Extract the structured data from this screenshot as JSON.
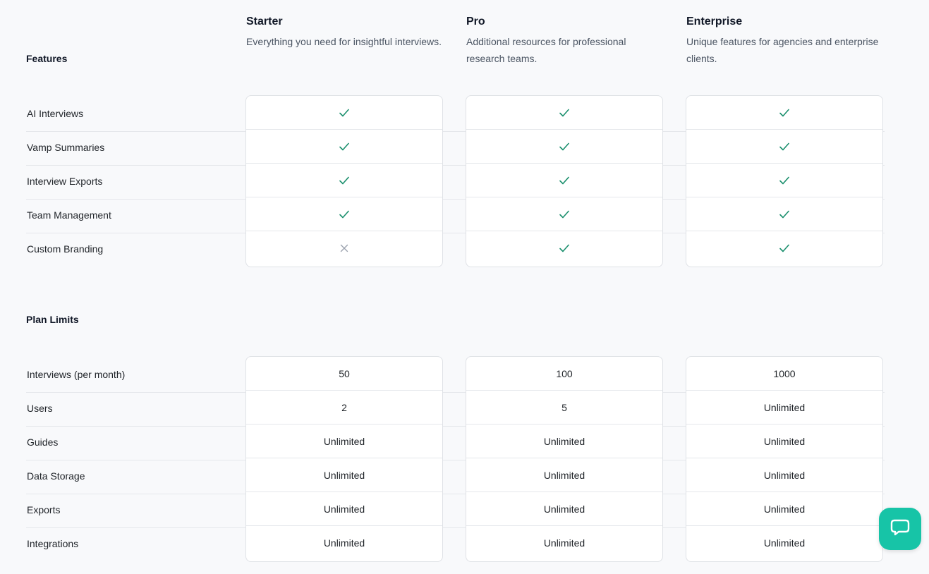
{
  "plans": [
    {
      "name": "Starter",
      "description": "Everything you need for insightful interviews."
    },
    {
      "name": "Pro",
      "description": "Additional resources for professional research teams."
    },
    {
      "name": "Enterprise",
      "description": "Unique features for agencies and enterprise clients."
    }
  ],
  "features": {
    "title": "Features",
    "rows": [
      {
        "label": "AI Interviews",
        "values": [
          "check",
          "check",
          "check"
        ]
      },
      {
        "label": "Vamp Summaries",
        "values": [
          "check",
          "check",
          "check"
        ]
      },
      {
        "label": "Interview Exports",
        "values": [
          "check",
          "check",
          "check"
        ]
      },
      {
        "label": "Team Management",
        "values": [
          "check",
          "check",
          "check"
        ]
      },
      {
        "label": "Custom Branding",
        "values": [
          "cross",
          "check",
          "check"
        ]
      }
    ]
  },
  "limits": {
    "title": "Plan Limits",
    "rows": [
      {
        "label": "Interviews (per month)",
        "values": [
          "50",
          "100",
          "1000"
        ]
      },
      {
        "label": "Users",
        "values": [
          "2",
          "5",
          "Unlimited"
        ]
      },
      {
        "label": "Guides",
        "values": [
          "Unlimited",
          "Unlimited",
          "Unlimited"
        ]
      },
      {
        "label": "Data Storage",
        "values": [
          "Unlimited",
          "Unlimited",
          "Unlimited"
        ]
      },
      {
        "label": "Exports",
        "values": [
          "Unlimited",
          "Unlimited",
          "Unlimited"
        ]
      },
      {
        "label": "Integrations",
        "values": [
          "Unlimited",
          "Unlimited",
          "Unlimited"
        ]
      }
    ]
  },
  "icons": {
    "check": "check-icon",
    "cross": "x-icon",
    "chat": "chat-bubble-icon"
  },
  "colors": {
    "check": "#1a8f6d",
    "cross": "#9ca3af",
    "chat_button": "#17c4a7"
  }
}
